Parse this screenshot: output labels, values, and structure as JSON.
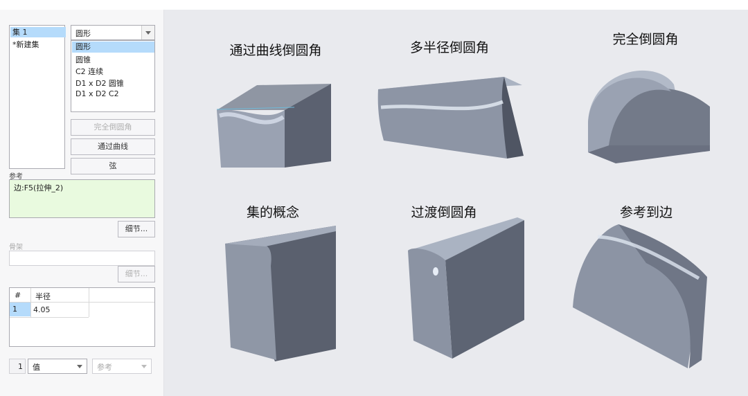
{
  "set_list": {
    "items": [
      "集 1",
      "*新建集"
    ]
  },
  "shape_select": {
    "value": "圆形",
    "options": [
      "圆形",
      "圆锥",
      "C2 连续",
      "D1 x D2 圆锥",
      "D1 x D2 C2"
    ]
  },
  "buttons": {
    "full_round": "完全倒圆角",
    "through_curve": "通过曲线",
    "chord": "弦"
  },
  "references": {
    "label": "参考",
    "value": "边:F5(拉伸_2)",
    "details": "细节..."
  },
  "spine": {
    "label": "骨架",
    "details": "细节..."
  },
  "radius_table": {
    "headers": [
      "#",
      "半径"
    ],
    "rows": [
      [
        "1",
        "4.05"
      ]
    ]
  },
  "bottom_bar": {
    "index": "1",
    "value_select": "值",
    "reference_select": "参考"
  },
  "examples": [
    "通过曲线倒圆角",
    "多半径倒圆角",
    "完全倒圆角",
    "集的概念",
    "过渡倒圆角",
    "参考到边"
  ]
}
